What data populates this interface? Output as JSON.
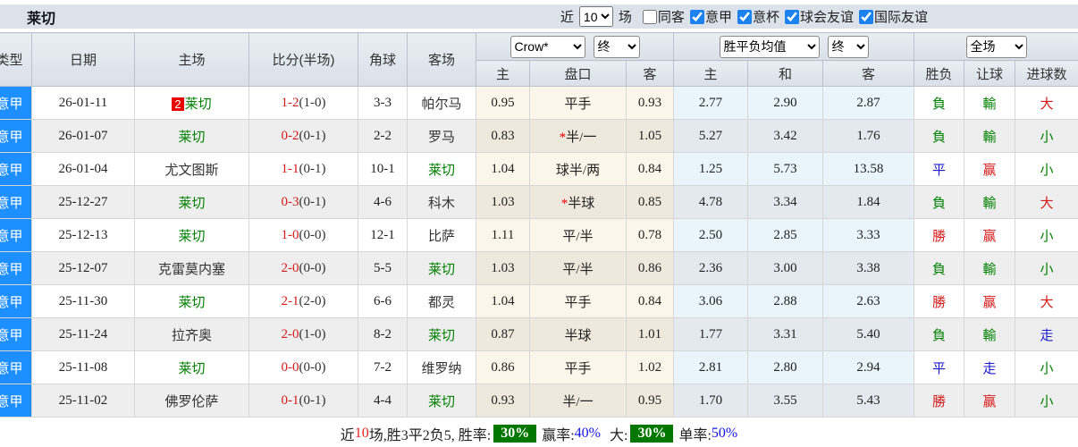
{
  "topbar": {
    "title": "莱切",
    "near_label": "近",
    "matches_count": "10",
    "matches_label": "场",
    "checkboxes": [
      {
        "label": "同客",
        "checked": false
      },
      {
        "label": "意甲",
        "checked": true
      },
      {
        "label": "意杯",
        "checked": true
      },
      {
        "label": "球会友谊",
        "checked": true
      },
      {
        "label": "国际友谊",
        "checked": true
      }
    ]
  },
  "header": {
    "static_cols": [
      "类型",
      "日期",
      "主场",
      "比分(半场)",
      "角球",
      "客场"
    ],
    "asian_selects": [
      "Crow*",
      "终"
    ],
    "euro_selects": [
      "胜平负均值",
      "终"
    ],
    "result_selects": [
      "全场"
    ],
    "sub_cols": [
      "主",
      "盘口",
      "客",
      "主",
      "和",
      "客",
      "胜负",
      "让球",
      "进球数"
    ]
  },
  "rows": [
    {
      "league": "意甲",
      "date": "26-01-11",
      "home": "莱切",
      "home_badge": "2",
      "home_is_team": true,
      "score_ft": "1-2",
      "score_ht": "(1-0)",
      "corner": "3-3",
      "away": "帕尔马",
      "away_is_team": false,
      "asian_home": "0.95",
      "handicap": "平手",
      "handicap_star": false,
      "asian_away": "0.93",
      "euro_home": "2.77",
      "euro_draw": "2.90",
      "euro_away": "2.87",
      "wdl": "負",
      "wdl_color": "green",
      "let": "輸",
      "let_color": "green",
      "goals": "大",
      "goals_color": "red"
    },
    {
      "league": "意甲",
      "date": "26-01-07",
      "home": "莱切",
      "home_badge": "",
      "home_is_team": true,
      "score_ft": "0-2",
      "score_ht": "(0-1)",
      "corner": "2-2",
      "away": "罗马",
      "away_is_team": false,
      "asian_home": "0.83",
      "handicap": "半/一",
      "handicap_star": true,
      "asian_away": "1.05",
      "euro_home": "5.27",
      "euro_draw": "3.42",
      "euro_away": "1.76",
      "wdl": "負",
      "wdl_color": "green",
      "let": "輸",
      "let_color": "green",
      "goals": "小",
      "goals_color": "green"
    },
    {
      "league": "意甲",
      "date": "26-01-04",
      "home": "尤文图斯",
      "home_badge": "",
      "home_is_team": false,
      "score_ft": "1-1",
      "score_ht": "(0-1)",
      "corner": "10-1",
      "away": "莱切",
      "away_is_team": true,
      "asian_home": "1.04",
      "handicap": "球半/两",
      "handicap_star": false,
      "asian_away": "0.84",
      "euro_home": "1.25",
      "euro_draw": "5.73",
      "euro_away": "13.58",
      "wdl": "平",
      "wdl_color": "blue",
      "let": "赢",
      "let_color": "red",
      "goals": "小",
      "goals_color": "green"
    },
    {
      "league": "意甲",
      "date": "25-12-27",
      "home": "莱切",
      "home_badge": "",
      "home_is_team": true,
      "score_ft": "0-3",
      "score_ht": "(0-1)",
      "corner": "4-6",
      "away": "科木",
      "away_is_team": false,
      "asian_home": "1.03",
      "handicap": "半球",
      "handicap_star": true,
      "asian_away": "0.85",
      "euro_home": "4.78",
      "euro_draw": "3.34",
      "euro_away": "1.84",
      "wdl": "負",
      "wdl_color": "green",
      "let": "輸",
      "let_color": "green",
      "goals": "大",
      "goals_color": "red"
    },
    {
      "league": "意甲",
      "date": "25-12-13",
      "home": "莱切",
      "home_badge": "",
      "home_is_team": true,
      "score_ft": "1-0",
      "score_ht": "(0-0)",
      "corner": "12-1",
      "away": "比萨",
      "away_is_team": false,
      "asian_home": "1.11",
      "handicap": "平/半",
      "handicap_star": false,
      "asian_away": "0.78",
      "euro_home": "2.50",
      "euro_draw": "2.85",
      "euro_away": "3.33",
      "wdl": "勝",
      "wdl_color": "red",
      "let": "赢",
      "let_color": "red",
      "goals": "小",
      "goals_color": "green"
    },
    {
      "league": "意甲",
      "date": "25-12-07",
      "home": "克雷莫内塞",
      "home_badge": "",
      "home_is_team": false,
      "score_ft": "2-0",
      "score_ht": "(0-0)",
      "corner": "5-5",
      "away": "莱切",
      "away_is_team": true,
      "asian_home": "1.03",
      "handicap": "平/半",
      "handicap_star": false,
      "asian_away": "0.86",
      "euro_home": "2.36",
      "euro_draw": "3.00",
      "euro_away": "3.38",
      "wdl": "負",
      "wdl_color": "green",
      "let": "輸",
      "let_color": "green",
      "goals": "小",
      "goals_color": "green"
    },
    {
      "league": "意甲",
      "date": "25-11-30",
      "home": "莱切",
      "home_badge": "",
      "home_is_team": true,
      "score_ft": "2-1",
      "score_ht": "(2-0)",
      "corner": "6-6",
      "away": "都灵",
      "away_is_team": false,
      "asian_home": "1.04",
      "handicap": "平手",
      "handicap_star": false,
      "asian_away": "0.84",
      "euro_home": "3.06",
      "euro_draw": "2.88",
      "euro_away": "2.63",
      "wdl": "勝",
      "wdl_color": "red",
      "let": "赢",
      "let_color": "red",
      "goals": "大",
      "goals_color": "red"
    },
    {
      "league": "意甲",
      "date": "25-11-24",
      "home": "拉齐奥",
      "home_badge": "",
      "home_is_team": false,
      "score_ft": "2-0",
      "score_ht": "(1-0)",
      "corner": "8-2",
      "away": "莱切",
      "away_is_team": true,
      "asian_home": "0.87",
      "handicap": "半球",
      "handicap_star": false,
      "asian_away": "1.01",
      "euro_home": "1.77",
      "euro_draw": "3.31",
      "euro_away": "5.40",
      "wdl": "負",
      "wdl_color": "green",
      "let": "輸",
      "let_color": "green",
      "goals": "走",
      "goals_color": "blue"
    },
    {
      "league": "意甲",
      "date": "25-11-08",
      "home": "莱切",
      "home_badge": "",
      "home_is_team": true,
      "score_ft": "0-0",
      "score_ht": "(0-0)",
      "corner": "7-2",
      "away": "维罗纳",
      "away_is_team": false,
      "asian_home": "0.86",
      "handicap": "平手",
      "handicap_star": false,
      "asian_away": "1.02",
      "euro_home": "2.81",
      "euro_draw": "2.80",
      "euro_away": "2.94",
      "wdl": "平",
      "wdl_color": "blue",
      "let": "走",
      "let_color": "blue",
      "goals": "小",
      "goals_color": "green"
    },
    {
      "league": "意甲",
      "date": "25-11-02",
      "home": "佛罗伦萨",
      "home_badge": "",
      "home_is_team": false,
      "score_ft": "0-1",
      "score_ht": "(0-1)",
      "corner": "4-4",
      "away": "莱切",
      "away_is_team": true,
      "asian_home": "0.93",
      "handicap": "半/一",
      "handicap_star": false,
      "asian_away": "0.95",
      "euro_home": "1.70",
      "euro_draw": "3.55",
      "euro_away": "5.43",
      "wdl": "勝",
      "wdl_color": "red",
      "let": "赢",
      "let_color": "red",
      "goals": "小",
      "goals_color": "green"
    }
  ],
  "summary": {
    "part_near": "近",
    "count": "10",
    "part_record": "场,胜3平2负5, 胜率:",
    "win_badge": "30%",
    "part_winrate": "赢率:",
    "win_rate": "40%",
    "part_big": "大:",
    "big_badge": "30%",
    "part_single": "单率:",
    "single_rate": "50%"
  },
  "colors": {
    "accent_blue": "#1e8fff",
    "win_red": "#d61a1a",
    "loss_green": "#008000",
    "draw_blue": "#1a1acc",
    "badge_green": "#007800"
  }
}
